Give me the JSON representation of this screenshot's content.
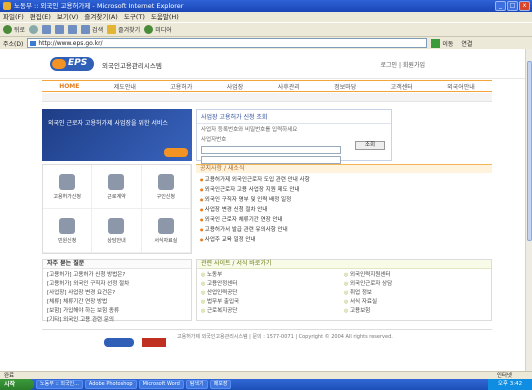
{
  "window": {
    "title": "노동부 :: 외국인 고용허가제 - Microsoft Internet Explorer",
    "controls": [
      "_",
      "□",
      "x"
    ]
  },
  "menubar": [
    "파일(F)",
    "편집(E)",
    "보기(V)",
    "즐겨찾기(A)",
    "도구(T)",
    "도움말(H)"
  ],
  "toolbar": {
    "back": "뒤로",
    "forward": "",
    "search": "검색",
    "favorites": "즐겨찾기",
    "media": "미디어"
  },
  "addressbar": {
    "label": "주소(D)",
    "url": "http://www.eps.go.kr/",
    "go": "이동",
    "links": "연결"
  },
  "site": {
    "logo_text": "EPS",
    "title": "외국인고용관리시스템",
    "util_links": "로그인 | 회원가입",
    "gnb": [
      "HOME",
      "제도안내",
      "고용허가",
      "사업장",
      "사후관리",
      "정보마당",
      "고객센터",
      "외국어안내"
    ],
    "banner_text": "외국인 근로자 고용허가제 사업장을 위한 서비스",
    "search": {
      "title": "사업장 고용허가 신청 조회",
      "line1": "사업자 등록번호와 비밀번호를 입력하세요",
      "line2": "사업자번호",
      "button": "조회"
    },
    "icons": [
      "고용허가신청",
      "근로계약",
      "구인신청",
      "민원신청",
      "상담안내",
      "서식자료실"
    ],
    "notice": {
      "title": "공지사항 / 새소식",
      "items": [
        "고용허가제 외국인근로자 도입 관련 안내 사항",
        "외국인근로자 고용 사업장 지원 제도 안내",
        "외국인 구직자 명부 및 인력 배정 일정",
        "사업장 변경 신청 절차 안내",
        "외국인 근로자 체류기간 연장 안내",
        "고용허가서 발급 관련 유의사항 안내",
        "사업주 교육 일정 안내"
      ]
    },
    "faq": {
      "title": "자주 묻는 질문",
      "items": [
        "[고용허가] 고용허가 신청 방법은?",
        "[고용허가] 외국인 구직자 선정 절차",
        "[사업장] 사업장 변경 요건은?",
        "[체류] 체류기간 연장 방법",
        "[보험] 가입해야 하는 보험 종류",
        "[기타] 외국인 고용 관련 문의"
      ]
    },
    "links": {
      "title": "관련 사이트 / 서식 바로가기",
      "col1": [
        "노동부",
        "고용안정센터",
        "산업인력공단",
        "법무부 출입국",
        "근로복지공단"
      ],
      "col2": [
        "외국인력지원센터",
        "외국인근로자 상담",
        "취업 정보",
        "서식 자료실",
        "고용보험"
      ]
    },
    "footer": "고용허가제 외국인고용관리시스템 | 문의 : 1577-0071 | Copyright © 2004 All rights reserved."
  },
  "statusbar": {
    "text": "완료",
    "zone": "인터넷"
  },
  "taskbar": {
    "start": "시작",
    "tasks": [
      "노동부 :: 외국인...",
      "Adobe Photoshop",
      "Microsoft Word",
      "탐색기",
      "메모장"
    ],
    "clock": "오후 3:42"
  }
}
